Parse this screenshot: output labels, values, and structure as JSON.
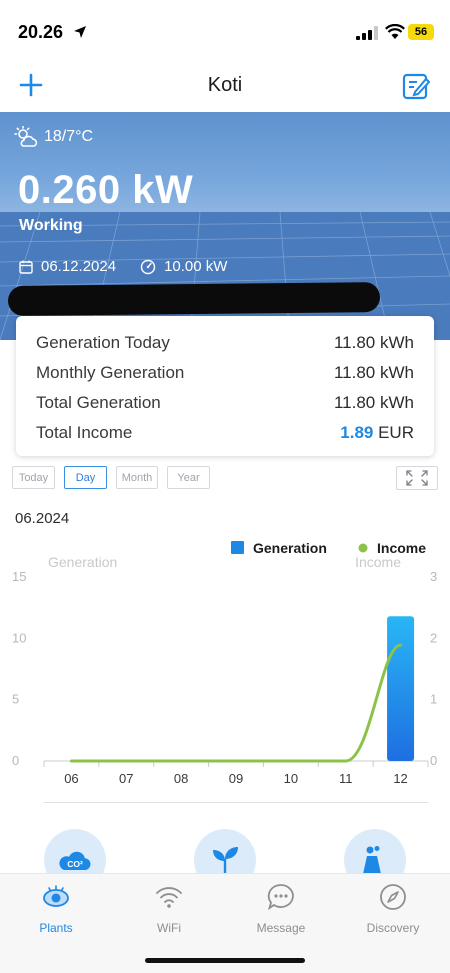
{
  "status_bar": {
    "time": "20.26",
    "battery": "56"
  },
  "nav": {
    "title": "Koti"
  },
  "hero": {
    "weather": "18/7°C",
    "power": "0.260 kW",
    "status": "Working",
    "date": "06.12.2024",
    "capacity": "10.00 kW"
  },
  "stats": [
    {
      "label": "Generation Today",
      "value": "11.80 kWh"
    },
    {
      "label": "Monthly Generation",
      "value": "11.80 kWh"
    },
    {
      "label": "Total Generation",
      "value": "11.80 kWh"
    }
  ],
  "income": {
    "label": "Total Income",
    "value": "1.89",
    "unit": "EUR"
  },
  "period_tabs": [
    "Today",
    "Day",
    "Month",
    "Year"
  ],
  "active_tab": "Day",
  "period": "06.2024",
  "chart_data": {
    "type": "bar",
    "categories": [
      "06",
      "07",
      "08",
      "09",
      "10",
      "11",
      "12"
    ],
    "series": [
      {
        "name": "Generation",
        "type": "bar",
        "axis": "left",
        "color": "#1e88e5",
        "values": [
          0,
          0,
          0,
          0,
          0,
          0,
          11.8
        ]
      },
      {
        "name": "Income",
        "type": "line",
        "axis": "right",
        "color": "#8bc34a",
        "values": [
          0,
          0,
          0,
          0,
          0,
          0,
          1.89
        ]
      }
    ],
    "ylabel": "Generation",
    "y2label": "Income",
    "ylim": [
      0,
      15
    ],
    "y2lim": [
      0,
      3
    ],
    "yticks": [
      "0",
      "5",
      "10",
      "15"
    ],
    "y2ticks": [
      "0",
      "1",
      "2",
      "3"
    ],
    "legend": "top-right",
    "legend_labels": [
      "Generation",
      "Income"
    ]
  },
  "tabbar": [
    {
      "label": "Plants",
      "icon": "eye-icon",
      "active": true
    },
    {
      "label": "WiFi",
      "icon": "wifi-icon",
      "active": false
    },
    {
      "label": "Message",
      "icon": "message-icon",
      "active": false
    },
    {
      "label": "Discovery",
      "icon": "compass-icon",
      "active": false
    }
  ],
  "colors": {
    "accent": "#1e88e5",
    "income_line": "#8bc34a"
  }
}
